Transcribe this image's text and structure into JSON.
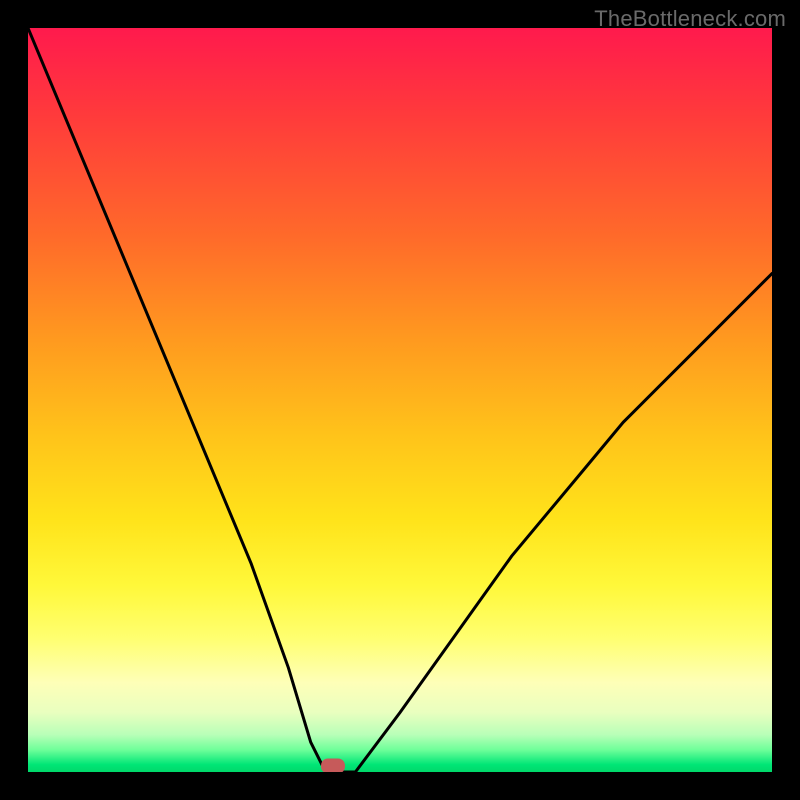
{
  "watermark": "TheBottleneck.com",
  "chart_data": {
    "type": "line",
    "title": "",
    "xlabel": "",
    "ylabel": "",
    "xlim": [
      0,
      100
    ],
    "ylim": [
      0,
      100
    ],
    "grid": false,
    "legend": false,
    "series": [
      {
        "name": "bottleneck-curve",
        "x": [
          0,
          5,
          10,
          15,
          20,
          25,
          30,
          35,
          38,
          40,
          42,
          44,
          50,
          55,
          60,
          65,
          70,
          75,
          80,
          85,
          90,
          95,
          100
        ],
        "y": [
          100,
          88,
          76,
          64,
          52,
          40,
          28,
          14,
          4,
          0,
          0,
          0,
          8,
          15,
          22,
          29,
          35,
          41,
          47,
          52,
          57,
          62,
          67
        ]
      }
    ],
    "marker": {
      "x": 41,
      "y": 0
    },
    "background_gradient": {
      "top": "#ff1a4d",
      "mid": "#ffe31a",
      "bottom": "#00d86a"
    }
  }
}
